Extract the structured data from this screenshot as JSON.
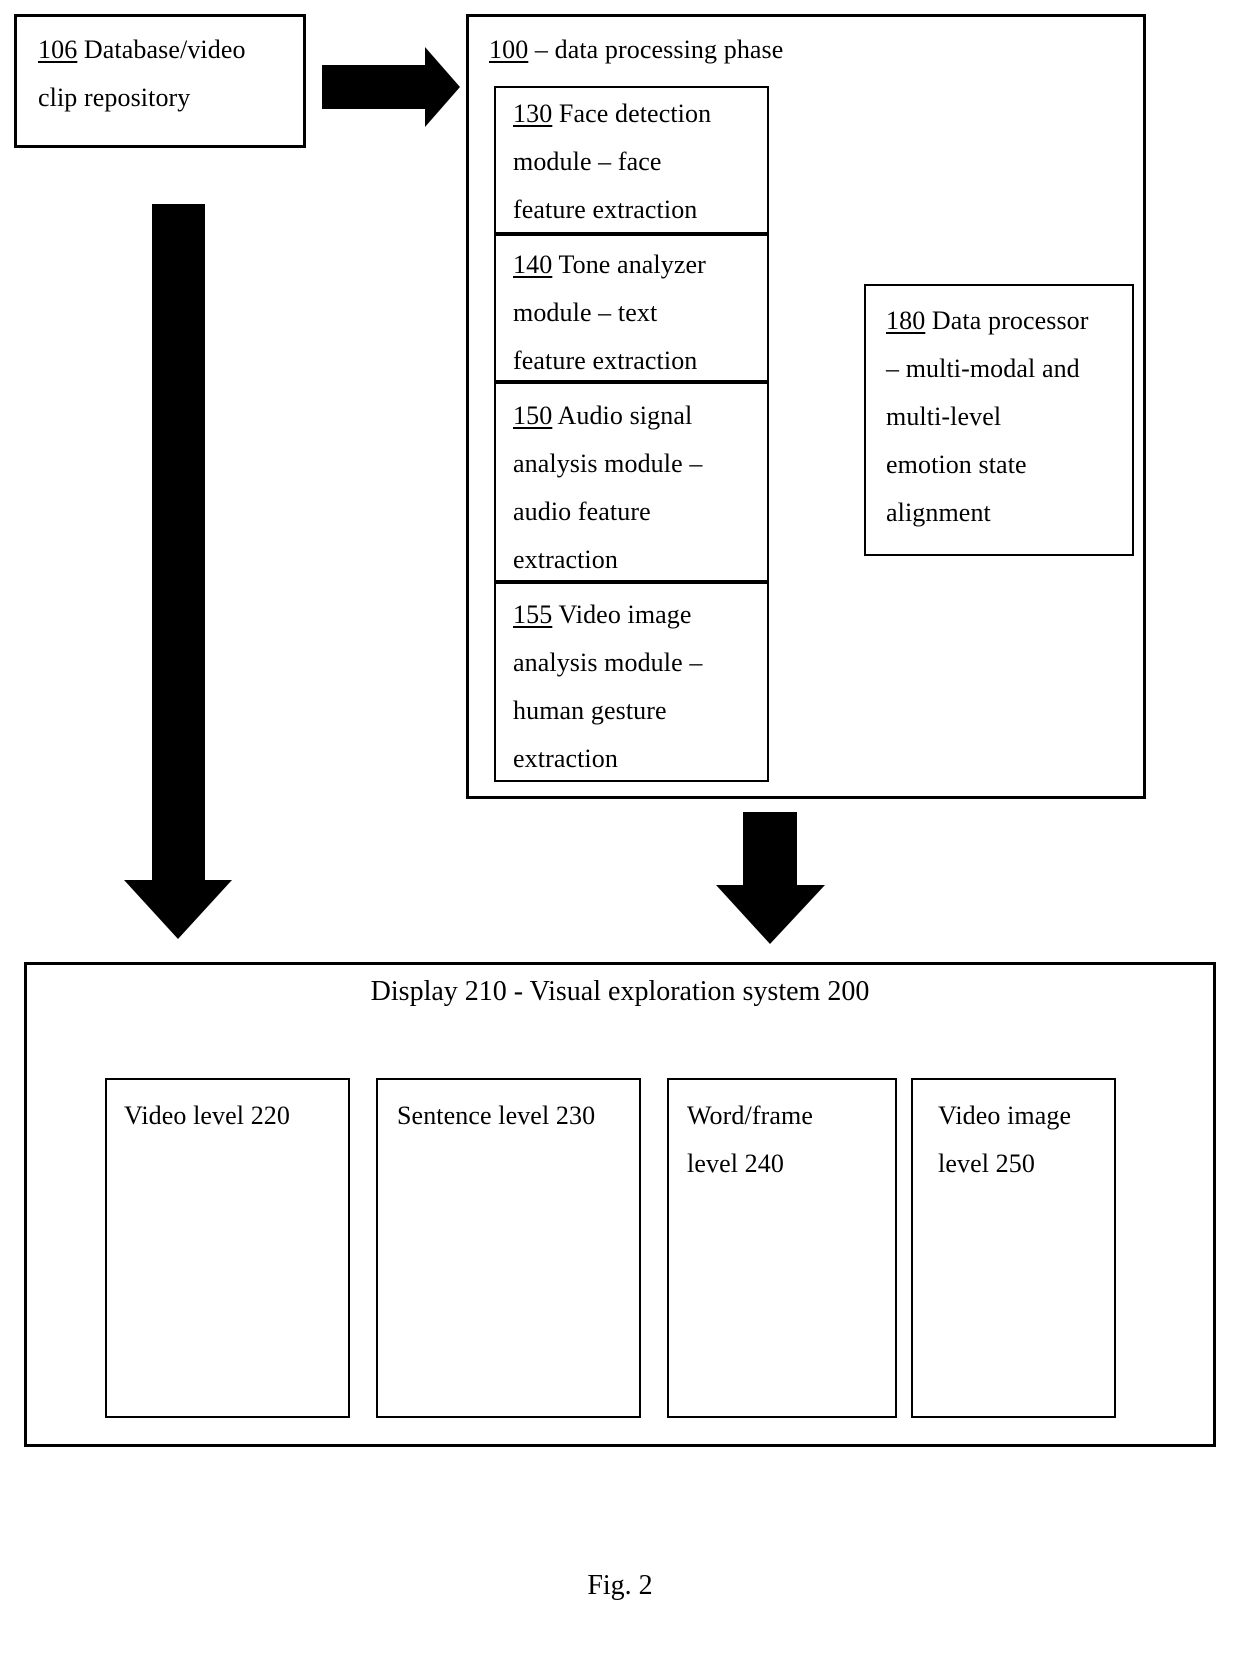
{
  "figure": {
    "caption": "Fig. 2"
  },
  "repository": {
    "ref": "106",
    "label": " Database/video\nclip repository"
  },
  "processing_phase": {
    "ref": "100",
    "label": " – data processing phase",
    "modules": [
      {
        "ref": "130",
        "label": " Face detection\nmodule – face\nfeature extraction"
      },
      {
        "ref": "140",
        "label": " Tone analyzer\nmodule – text\nfeature extraction"
      },
      {
        "ref": "150",
        "label": " Audio signal\nanalysis module –\naudio feature\nextraction"
      },
      {
        "ref": "155",
        "label": " Video image\nanalysis module –\nhuman gesture\nextraction"
      }
    ]
  },
  "data_processor": {
    "ref": "180",
    "label": " Data processor\n– multi-modal and\nmulti-level\nemotion state\nalignment"
  },
  "display_system": {
    "title": "Display 210 - Visual exploration system 200",
    "levels": [
      {
        "label": "Video level 220"
      },
      {
        "label": "Sentence level 230"
      },
      {
        "label": "Word/frame\nlevel 240"
      },
      {
        "label": "Video image\nlevel 250"
      }
    ]
  },
  "colors": {
    "stroke": "#000000",
    "fill": "#ffffff",
    "arrow_fill": "#000000"
  }
}
